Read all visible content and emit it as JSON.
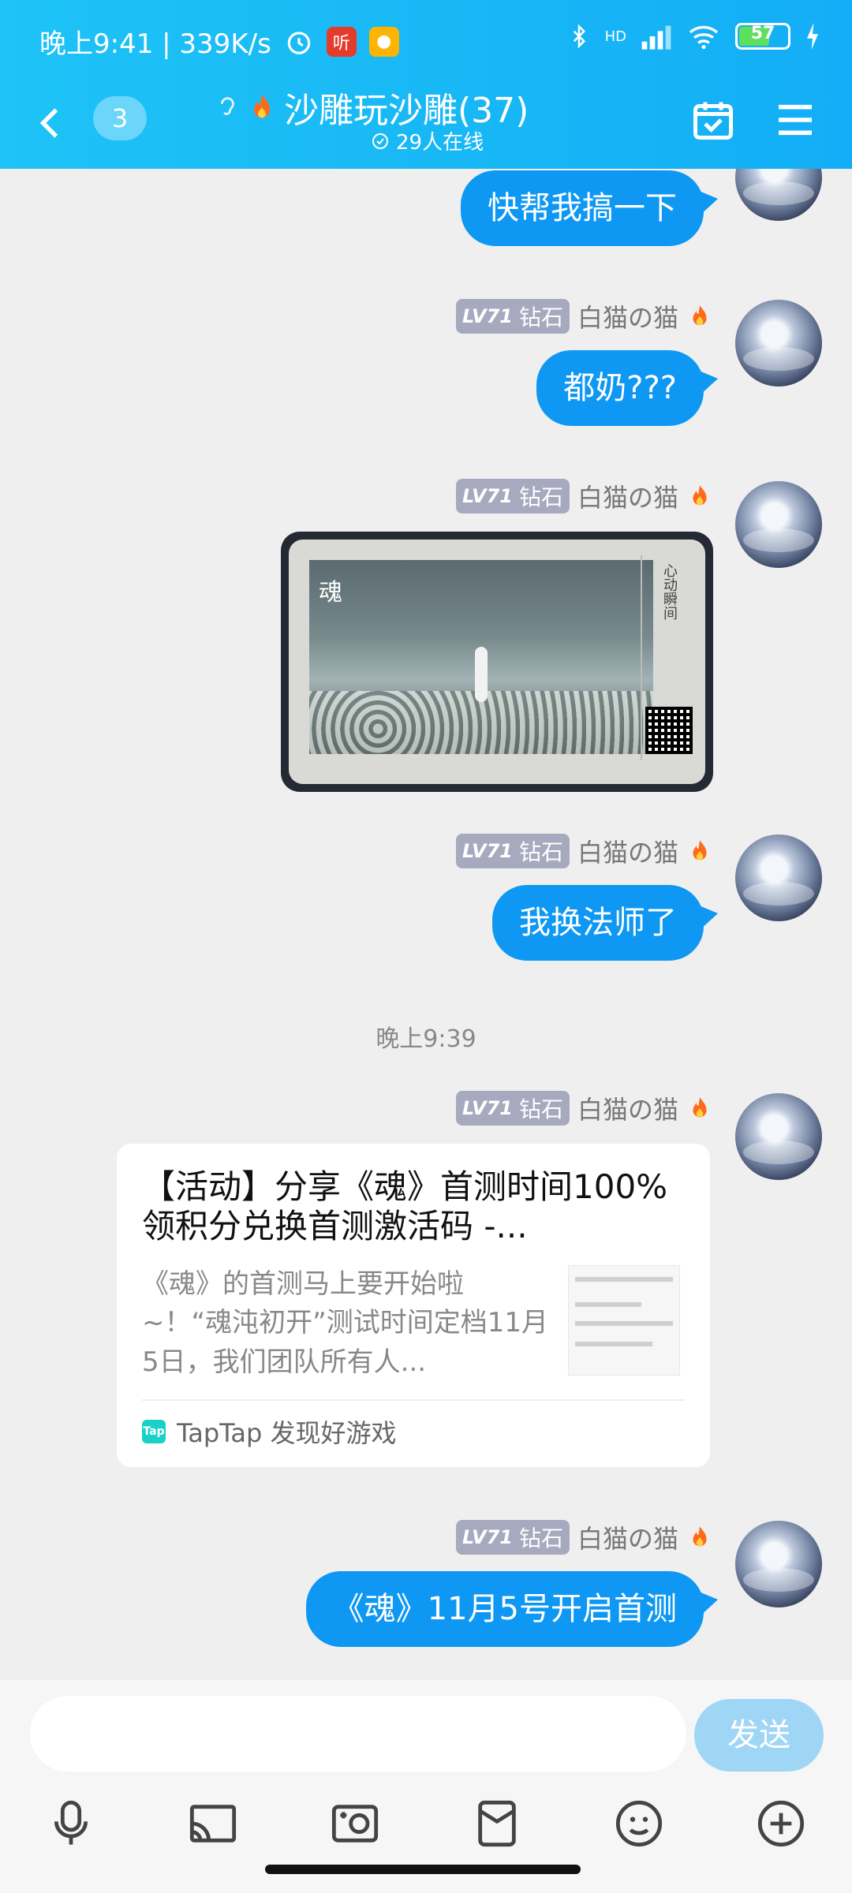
{
  "status_bar": {
    "time_speed": "晚上9:41 | 339K/s",
    "app_badge_1": "听",
    "network": "HD",
    "battery": "57"
  },
  "header": {
    "unread_count": "3",
    "title": "沙雕玩沙雕(37)",
    "online": "29人在线"
  },
  "messages": [
    {
      "type": "text",
      "text": "快帮我搞一下"
    },
    {
      "type": "text",
      "sender": "白猫の猫",
      "level": "LV71",
      "rank": "钻石",
      "text": "都奶???"
    },
    {
      "type": "image",
      "sender": "白猫の猫",
      "level": "LV71",
      "rank": "钻石",
      "image_logo": "魂",
      "image_side_text": "心动瞬间"
    },
    {
      "type": "text",
      "sender": "白猫の猫",
      "level": "LV71",
      "rank": "钻石",
      "text": "我换法师了"
    },
    {
      "type": "timestamp",
      "text": "晚上9:39"
    },
    {
      "type": "card",
      "sender": "白猫の猫",
      "level": "LV71",
      "rank": "钻石",
      "title": "【活动】分享《魂》首测时间100%领积分兑换首测激活码 -...",
      "description": "《魂》的首测马上要开始啦~！“魂沌初开”测试时间定档11月5日，我们团队所有人...",
      "source": "TapTap 发现好游戏",
      "source_logo": "Tap"
    },
    {
      "type": "text",
      "sender": "白猫の猫",
      "level": "LV71",
      "rank": "钻石",
      "text": "《魂》11月5号开启首测"
    }
  ],
  "composer": {
    "input_value": "",
    "send_label": "发送"
  },
  "colors": {
    "header": "#17b6f5",
    "bubble": "#0e98f3",
    "send_disabled": "#9fd6f6"
  },
  "toolbar_icons": [
    "microphone-icon",
    "cast-screen-icon",
    "image-icon",
    "red-packet-icon",
    "emoji-icon",
    "plus-icon"
  ]
}
